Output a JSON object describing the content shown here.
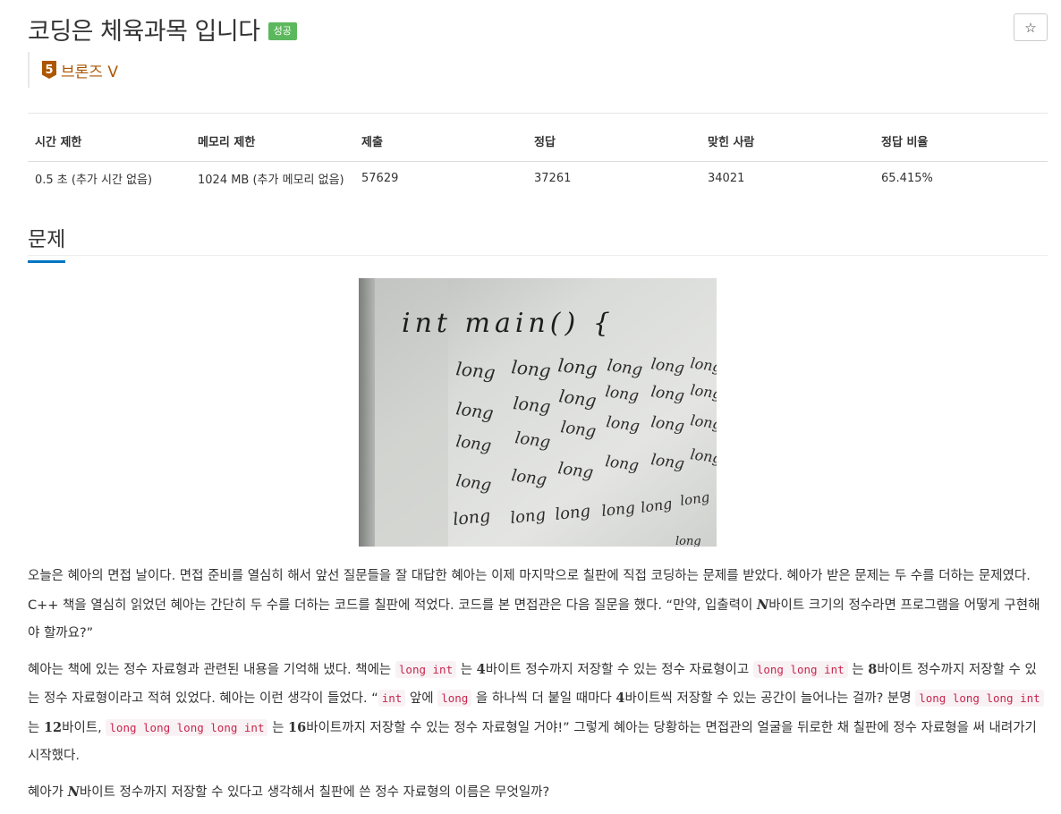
{
  "problem": {
    "title": "코딩은 체육과목 입니다",
    "status_badge": "성공",
    "star_icon": "☆",
    "tier": {
      "number": "5",
      "label": "브론즈 V",
      "color": "#ad5600"
    }
  },
  "info_table": {
    "headers": [
      "시간 제한",
      "메모리 제한",
      "제출",
      "정답",
      "맞힌 사람",
      "정답 비율"
    ],
    "row": [
      "0.5 초 (추가 시간 없음)",
      "1024 MB (추가 메모리 없음)",
      "57629",
      "37261",
      "34021",
      "65.415%"
    ]
  },
  "section": {
    "title": "문제"
  },
  "whiteboard": {
    "line1": "int main() {",
    "word": "long"
  },
  "description": {
    "p1": "오늘은 혜아의 면접 날이다. 면접 준비를 열심히 해서 앞선 질문들을 잘 대답한 혜아는 이제 마지막으로 칠판에 직접 코딩하는 문제를 받았다. 혜아가 받은 문제는 두 수를 더하는 문제였다. C++ 책을 열심히 읽었던 혜아는 간단히 두 수를 더하는 코드를 칠판에 적었다. 코드를 본 면접관은 다음 질문을 했다. “만약, 입출력이",
    "p1_var": "N",
    "p1_end": "바이트 크기의 정수라면 프로그램을 어떻게 구현해야 할까요?”",
    "p2_a": "혜아는 책에 있는 정수 자료형과 관련된 내용을 기억해 냈다. 책에는",
    "p2_code1": "long int",
    "p2_b": "는",
    "p2_n4": "4",
    "p2_c": "바이트 정수까지 저장할 수 있는 정수 자료형이고",
    "p2_code2": "long long int",
    "p2_d": "는",
    "p2_n8": "8",
    "p2_e": "바이트 정수까지 저장할 수 있는 정수 자료형이라고 적혀 있었다. 혜아는 이런 생각이 들었다. “",
    "p2_code3": "int",
    "p2_f": "앞에",
    "p2_code4": "long",
    "p2_g": "을 하나씩 더 붙일 때마다",
    "p2_n4b": "4",
    "p2_h": "바이트씩 저장할 수 있는 공간이 늘어나는 걸까? 분명",
    "p2_code5": "long long long int",
    "p2_i": "는",
    "p2_n12": "12",
    "p2_j": "바이트,",
    "p2_code6": "long long long long int",
    "p2_k": "는",
    "p2_n16": "16",
    "p2_l": "바이트까지 저장할 수 있는 정수 자료형일 거야!” 그렇게 혜아는 당황하는 면접관의 얼굴을 뒤로한 채 칠판에 정수 자료형을 써 내려가기 시작했다.",
    "p3_a": "혜아가",
    "p3_var": "N",
    "p3_b": "바이트 정수까지 저장할 수 있다고 생각해서 칠판에 쓴 정수 자료형의 이름은 무엇일까?"
  }
}
